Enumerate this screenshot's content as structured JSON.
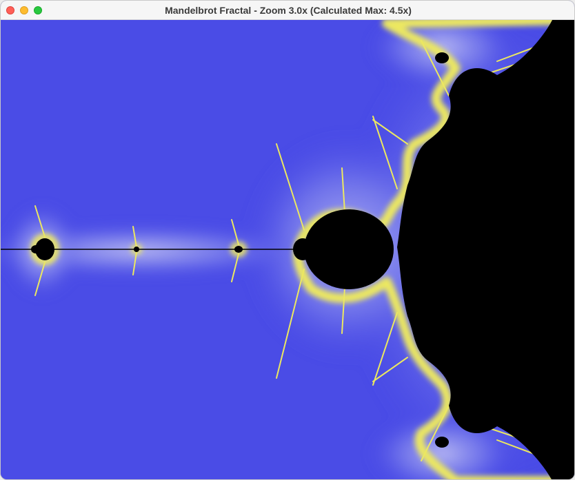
{
  "window": {
    "title": "Mandelbrot Fractal - Zoom 3.0x (Calculated Max: 4.5x)",
    "controls": [
      "close",
      "minimize",
      "maximize"
    ]
  },
  "fractal_view": {
    "render": "mandelbrot-set",
    "zoom": 3.0,
    "calculated_max_zoom": 4.5,
    "colors": {
      "background": "#4a4ce6",
      "halo": "#9a9ef0",
      "boundary": "#ece860",
      "set": "#000000"
    }
  }
}
